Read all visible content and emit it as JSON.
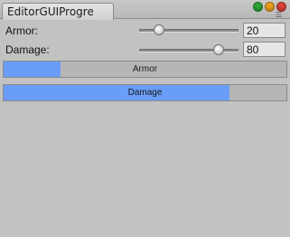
{
  "window": {
    "tab_title": "EditorGUIProgre",
    "buttons": {
      "close_color": "#2fa63a",
      "minimize_color": "#f0a21f",
      "zoom_color": "#e0453a"
    },
    "menu_icon": "menu-lines-icon"
  },
  "fields": {
    "armor": {
      "label": "Armor:",
      "value": "20",
      "fraction": 0.2
    },
    "damage": {
      "label": "Damage:",
      "value": "80",
      "fraction": 0.8
    }
  },
  "bars": {
    "armor": {
      "label": "Armor",
      "fraction": 0.2,
      "fill_color": "#6a9df7"
    },
    "damage": {
      "label": "Damage",
      "fraction": 0.8,
      "fill_color": "#6a9df7"
    }
  }
}
